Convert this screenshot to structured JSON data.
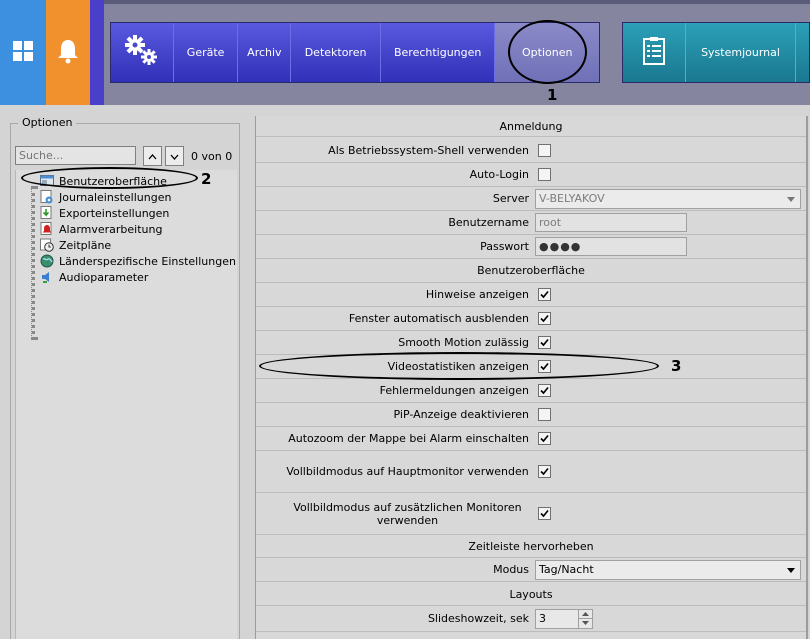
{
  "toolbar": {
    "tabs": [
      "Geräte",
      "Archiv",
      "Detektoren",
      "Berechtigungen",
      "Optionen"
    ],
    "journal": "Systemjournal"
  },
  "annotations": [
    "1",
    "2",
    "3"
  ],
  "left_panel": {
    "title": "Optionen",
    "search_placeholder": "Suche...",
    "search_count": "0 von 0",
    "tree": [
      {
        "label": "Benutzeroberfläche",
        "icon": "monitor-window-icon"
      },
      {
        "label": "Journaleinstellungen",
        "icon": "journal-gear-icon"
      },
      {
        "label": "Exportein­stellungen",
        "icon": "export-arrow-icon"
      },
      {
        "label": "Alarmverarbeitung",
        "icon": "alarm-bell-icon"
      },
      {
        "label": "Zeitpläne",
        "icon": "clock-calendar-icon"
      },
      {
        "label": "Länderspezifische Einstellungen",
        "icon": "globe-icon"
      },
      {
        "label": "Audioparameter",
        "icon": "speaker-icon"
      }
    ]
  },
  "grid": {
    "sections": {
      "anmeldung": "Anmeldung",
      "ui": "Benutzeroberfläche",
      "timeline": "Zeitleiste hervorheben",
      "layouts": "Layouts"
    },
    "login": {
      "shell_label": "Als Betriebssystem-Shell verwenden",
      "shell_checked": false,
      "autologin_label": "Auto-Login",
      "autologin_checked": false,
      "server_label": "Server",
      "server_value": "V-BELYAKOV",
      "user_label": "Benutzername",
      "user_value": "root",
      "pass_label": "Passwort",
      "pass_value": "●●●●"
    },
    "ui_rows": [
      {
        "label": "Hinweise anzeigen",
        "checked": true
      },
      {
        "label": "Fenster automatisch ausblenden",
        "checked": true
      },
      {
        "label": "Smooth Motion zulässig",
        "checked": true
      },
      {
        "label": "Videostatistiken anzeigen",
        "checked": true
      },
      {
        "label": "Fehlermeldungen anzeigen",
        "checked": true
      },
      {
        "label": "PiP-Anzeige deaktivieren",
        "checked": false
      },
      {
        "label": "Autozoom der Mappe bei Alarm einschalten",
        "checked": true
      },
      {
        "label": "Vollbildmodus auf Hauptmonitor verwenden",
        "checked": true
      },
      {
        "label": "Vollbildmodus auf zusätzlichen Monitoren verwenden",
        "checked": true
      }
    ],
    "timeline": {
      "mode_label": "Modus",
      "mode_value": "Tag/Nacht"
    },
    "layouts": {
      "slideshow_label": "Slideshowzeit, sek",
      "slideshow_value": "3"
    }
  },
  "colors": {
    "windows_tile": "#3d8fe0",
    "bell_tile": "#f0912e",
    "nav_main": "#4040c8",
    "nav_journal": "#2290a8"
  }
}
